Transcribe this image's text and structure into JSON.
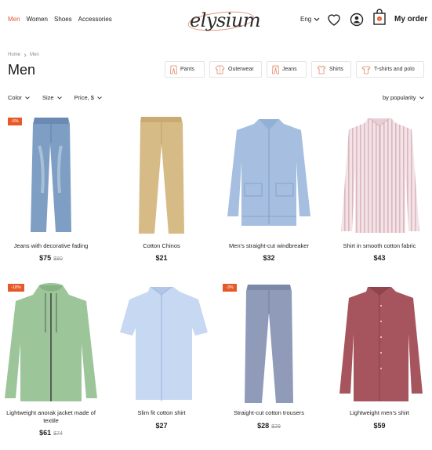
{
  "header": {
    "categories": [
      {
        "label": "Men",
        "active": true
      },
      {
        "label": "Women",
        "active": false
      },
      {
        "label": "Shoes",
        "active": false
      },
      {
        "label": "Accessories",
        "active": false
      }
    ],
    "logo": "elysium",
    "language": "Eng",
    "cart_count": "1",
    "my_order": "My order"
  },
  "breadcrumb": {
    "home": "Home",
    "current": "Men"
  },
  "page_title": "Men",
  "chips": [
    "Pants",
    "Outerwear",
    "Jeans",
    "Shirts",
    "T-shirts and polo"
  ],
  "filters": {
    "color": "Color",
    "size": "Size",
    "price": "Price, $",
    "sort": "by popularity"
  },
  "products": [
    {
      "name": "Jeans with decorative fading",
      "price": "$75",
      "old_price": "$80",
      "badge": "-6%",
      "color": "#7f9ec4"
    },
    {
      "name": "Cotton Chinos",
      "price": "$21",
      "old_price": "",
      "badge": "",
      "color": "#d7bb86"
    },
    {
      "name": "Men's straight-cut windbreaker",
      "price": "$32",
      "old_price": "",
      "badge": "",
      "color": "#a6bfe0"
    },
    {
      "name": "Shirt in smooth cotton fabric",
      "price": "$43",
      "old_price": "",
      "badge": "",
      "color": "#efd9de"
    },
    {
      "name": "Lightweight anorak jacket made of textile",
      "price": "$61",
      "old_price": "$74",
      "badge": "-18%",
      "color": "#9cc59a"
    },
    {
      "name": "Slim fit cotton shirt",
      "price": "$27",
      "old_price": "",
      "badge": "",
      "color": "#c7d8f2"
    },
    {
      "name": "Straight-cut cotton trousers",
      "price": "$28",
      "old_price": "$29",
      "badge": "-3%",
      "color": "#8f9bb8"
    },
    {
      "name": "Lightweight men's shirt",
      "price": "$59",
      "old_price": "",
      "badge": "",
      "color": "#a6545e"
    }
  ]
}
